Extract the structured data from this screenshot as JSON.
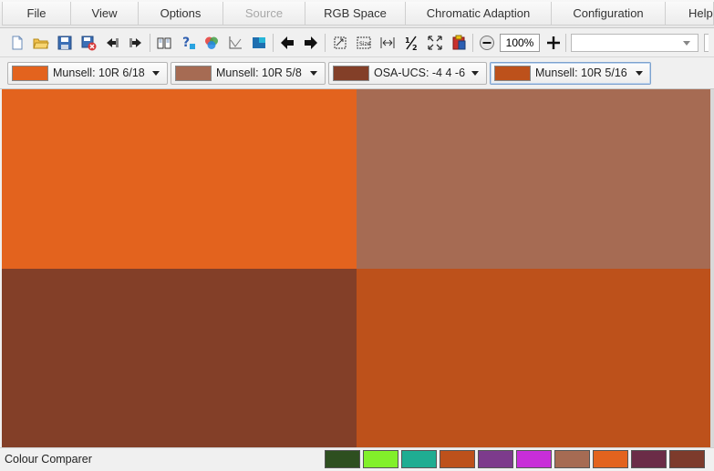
{
  "menu": {
    "items": [
      {
        "label": "File"
      },
      {
        "label": "View"
      },
      {
        "label": "Options"
      },
      {
        "label": "Source",
        "disabled": true
      },
      {
        "label": "RGB Space"
      },
      {
        "label": "Chromatic Adaption"
      },
      {
        "label": "Configuration"
      },
      {
        "label": "Help"
      }
    ]
  },
  "toolbar": {
    "zoom": "100%",
    "profile_value": "",
    "icons": [
      "new-file-icon",
      "open-folder-icon",
      "save-icon",
      "close-file-icon",
      "import-icon",
      "export-icon",
      "book-icon",
      "help-icon",
      "colour-wheel-icon",
      "graph-icon",
      "gamut-icon",
      "back-arrow-icon",
      "forward-arrow-icon",
      "rotate-icon",
      "size-icon",
      "fit-width-icon",
      "half-icon",
      "fullscreen-icon",
      "clipboard-icon",
      "zoom-out-icon",
      "zoom-in-icon"
    ]
  },
  "selectors": [
    {
      "label": "Munsell: 10R 6/18",
      "color": "#e3631e"
    },
    {
      "label": "Munsell: 10R 5/8",
      "color": "#a66b53"
    },
    {
      "label": "OSA-UCS: -4 4 -6",
      "color": "#833f28"
    },
    {
      "label": "Munsell: 10R 5/16",
      "color": "#bd511b"
    }
  ],
  "compare": {
    "tiles": [
      "#e3631e",
      "#a66b53",
      "#833f28",
      "#bd511b"
    ]
  },
  "status": {
    "text": "Colour Comparer",
    "palette": [
      "#2e4f20",
      "#82f02a",
      "#1fad92",
      "#bd511b",
      "#7d3b8c",
      "#c82ed8",
      "#a66b53",
      "#e3631e",
      "#6b2c47",
      "#7d3b2c"
    ]
  }
}
